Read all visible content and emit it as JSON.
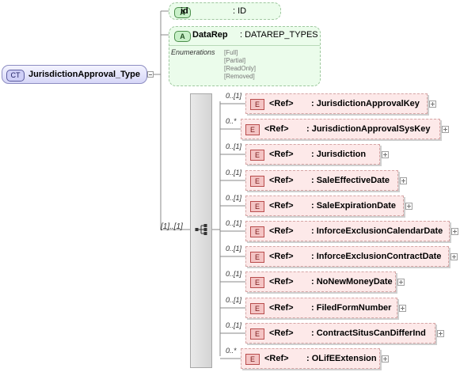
{
  "complex_type": {
    "badge": "CT",
    "name": "JurisdictionApproval_Type"
  },
  "attributes": [
    {
      "badge": "A",
      "name": "id",
      "type": ": ID"
    },
    {
      "badge": "A",
      "name": "DataRep",
      "type": ": DATAREP_TYPES",
      "enumerations_label": "Enumerations",
      "enumerations": [
        "[Full]",
        "[Partial]",
        "[ReadOnly]",
        "[Removed]"
      ]
    }
  ],
  "sequence": {
    "cardinality": "[1]..[1]"
  },
  "elements": [
    {
      "badge": "E",
      "ref": "<Ref>",
      "name": ": JurisdictionApprovalKey",
      "cardinality": "0..[1]"
    },
    {
      "badge": "E",
      "ref": "<Ref>",
      "name": ": JurisdictionApprovalSysKey",
      "cardinality": "0..*"
    },
    {
      "badge": "E",
      "ref": "<Ref>",
      "name": ": Jurisdiction",
      "cardinality": "0..[1]"
    },
    {
      "badge": "E",
      "ref": "<Ref>",
      "name": ": SaleEffectiveDate",
      "cardinality": "0..[1]"
    },
    {
      "badge": "E",
      "ref": "<Ref>",
      "name": ": SaleExpirationDate",
      "cardinality": "0..[1]"
    },
    {
      "badge": "E",
      "ref": "<Ref>",
      "name": ": InforceExclusionCalendarDate",
      "cardinality": "0..[1]"
    },
    {
      "badge": "E",
      "ref": "<Ref>",
      "name": ": InforceExclusionContractDate",
      "cardinality": "0..[1]"
    },
    {
      "badge": "E",
      "ref": "<Ref>",
      "name": ": NoNewMoneyDate",
      "cardinality": "0..[1]"
    },
    {
      "badge": "E",
      "ref": "<Ref>",
      "name": ": FiledFormNumber",
      "cardinality": "0..[1]"
    },
    {
      "badge": "E",
      "ref": "<Ref>",
      "name": ": ContractSitusCanDifferInd",
      "cardinality": "0..[1]"
    },
    {
      "badge": "E",
      "ref": "<Ref>",
      "name": ": OLifEExtension",
      "cardinality": "0..*"
    }
  ],
  "colors": {
    "complex_type_fill": "#d6d6f7",
    "attribute_fill": "#ebfceb",
    "element_fill": "#fde9e9",
    "sequence_fill": "#d4d4d4"
  }
}
